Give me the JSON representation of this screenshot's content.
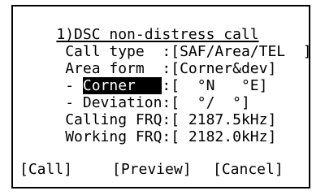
{
  "screen": {
    "title": "1)DSC non-distress call",
    "rows": [
      {
        "label": " Call type  ",
        "sep": ":",
        "value": "[SAF/Area/TEL  ]"
      },
      {
        "label": " Area form  ",
        "sep": ":",
        "value": "[Corner&dev]"
      },
      {
        "prefix": " - ",
        "label": "Corner   ",
        "sep": ":",
        "value": "[  °N   °E]"
      },
      {
        "label": " - Deviation",
        "sep": ":",
        "value": "[  °/  °]"
      },
      {
        "label": " Calling FRQ",
        "sep": ":",
        "value": "[ 2187.5kHz]"
      },
      {
        "label": " Working FRQ",
        "sep": ":",
        "value": "[ 2182.0kHz]"
      }
    ]
  },
  "softkeys": {
    "call": "[Call]",
    "preview": "[Preview]",
    "cancel": "[Cancel]"
  }
}
